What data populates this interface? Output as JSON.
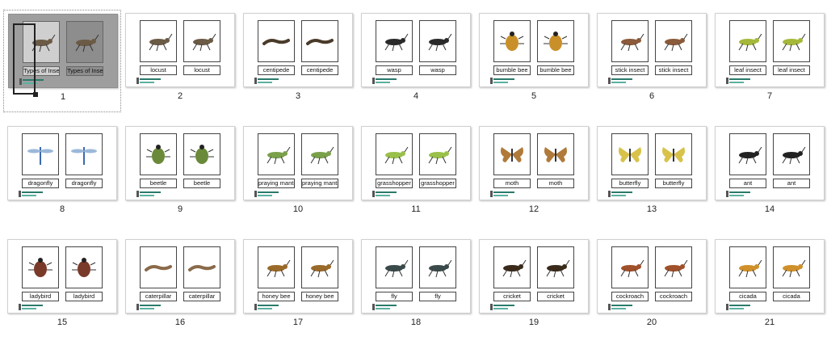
{
  "colors": {
    "selected_bg": "#9e9e9e",
    "page_bg": "#ffffff",
    "footer_accent": "#2a7a6b"
  },
  "pages": [
    {
      "number": "1",
      "title_left": "Types of Insects",
      "title_right": "Types of Insects",
      "icon": "grasshopper-icon",
      "color": "#6b5a45",
      "selected": true
    },
    {
      "number": "2",
      "title_left": "locust",
      "title_right": "locust",
      "icon": "locust-icon",
      "color": "#6b5a45"
    },
    {
      "number": "3",
      "title_left": "centipede",
      "title_right": "centipede",
      "icon": "centipede-icon",
      "color": "#4a3a2a"
    },
    {
      "number": "4",
      "title_left": "wasp",
      "title_right": "wasp",
      "icon": "wasp-icon",
      "color": "#2a2a2a"
    },
    {
      "number": "5",
      "title_left": "bumble bee",
      "title_right": "bumble bee",
      "icon": "bumble-bee-icon",
      "color": "#c9902a"
    },
    {
      "number": "6",
      "title_left": "stick insect",
      "title_right": "stick insect",
      "icon": "stick-insect-icon",
      "color": "#8a5a3a"
    },
    {
      "number": "7",
      "title_left": "leaf insect",
      "title_right": "leaf insect",
      "icon": "leaf-insect-icon",
      "color": "#a6b83a"
    },
    {
      "number": "8",
      "title_left": "dragonfly",
      "title_right": "dragonfly",
      "icon": "dragonfly-icon",
      "color": "#3a6ab0"
    },
    {
      "number": "9",
      "title_left": "beetle",
      "title_right": "beetle",
      "icon": "beetle-icon",
      "color": "#6a8a3a"
    },
    {
      "number": "10",
      "title_left": "praying mantis",
      "title_right": "praying mantis",
      "icon": "praying-mantis-icon",
      "color": "#7aa04a"
    },
    {
      "number": "11",
      "title_left": "grasshopper",
      "title_right": "grasshopper",
      "icon": "grasshopper-icon",
      "color": "#9ac04a"
    },
    {
      "number": "12",
      "title_left": "moth",
      "title_right": "moth",
      "icon": "moth-icon",
      "color": "#b07a3a"
    },
    {
      "number": "13",
      "title_left": "butterfly",
      "title_right": "butterfly",
      "icon": "butterfly-icon",
      "color": "#d8c24a"
    },
    {
      "number": "14",
      "title_left": "ant",
      "title_right": "ant",
      "icon": "ant-icon",
      "color": "#222222"
    },
    {
      "number": "15",
      "title_left": "ladybird",
      "title_right": "ladybird",
      "icon": "ladybird-icon",
      "color": "#7a3a2a"
    },
    {
      "number": "16",
      "title_left": "caterpillar",
      "title_right": "caterpillar",
      "icon": "caterpillar-icon",
      "color": "#8a6a4a"
    },
    {
      "number": "17",
      "title_left": "honey bee",
      "title_right": "honey bee",
      "icon": "honey-bee-icon",
      "color": "#9a6a2a"
    },
    {
      "number": "18",
      "title_left": "fly",
      "title_right": "fly",
      "icon": "fly-icon",
      "color": "#3a4a4a"
    },
    {
      "number": "19",
      "title_left": "cricket",
      "title_right": "cricket",
      "icon": "cricket-icon",
      "color": "#3a2a1a"
    },
    {
      "number": "20",
      "title_left": "cockroach",
      "title_right": "cockroach",
      "icon": "cockroach-icon",
      "color": "#a0502a"
    },
    {
      "number": "21",
      "title_left": "cicada",
      "title_right": "cicada",
      "icon": "cicada-icon",
      "color": "#d0902a"
    }
  ]
}
